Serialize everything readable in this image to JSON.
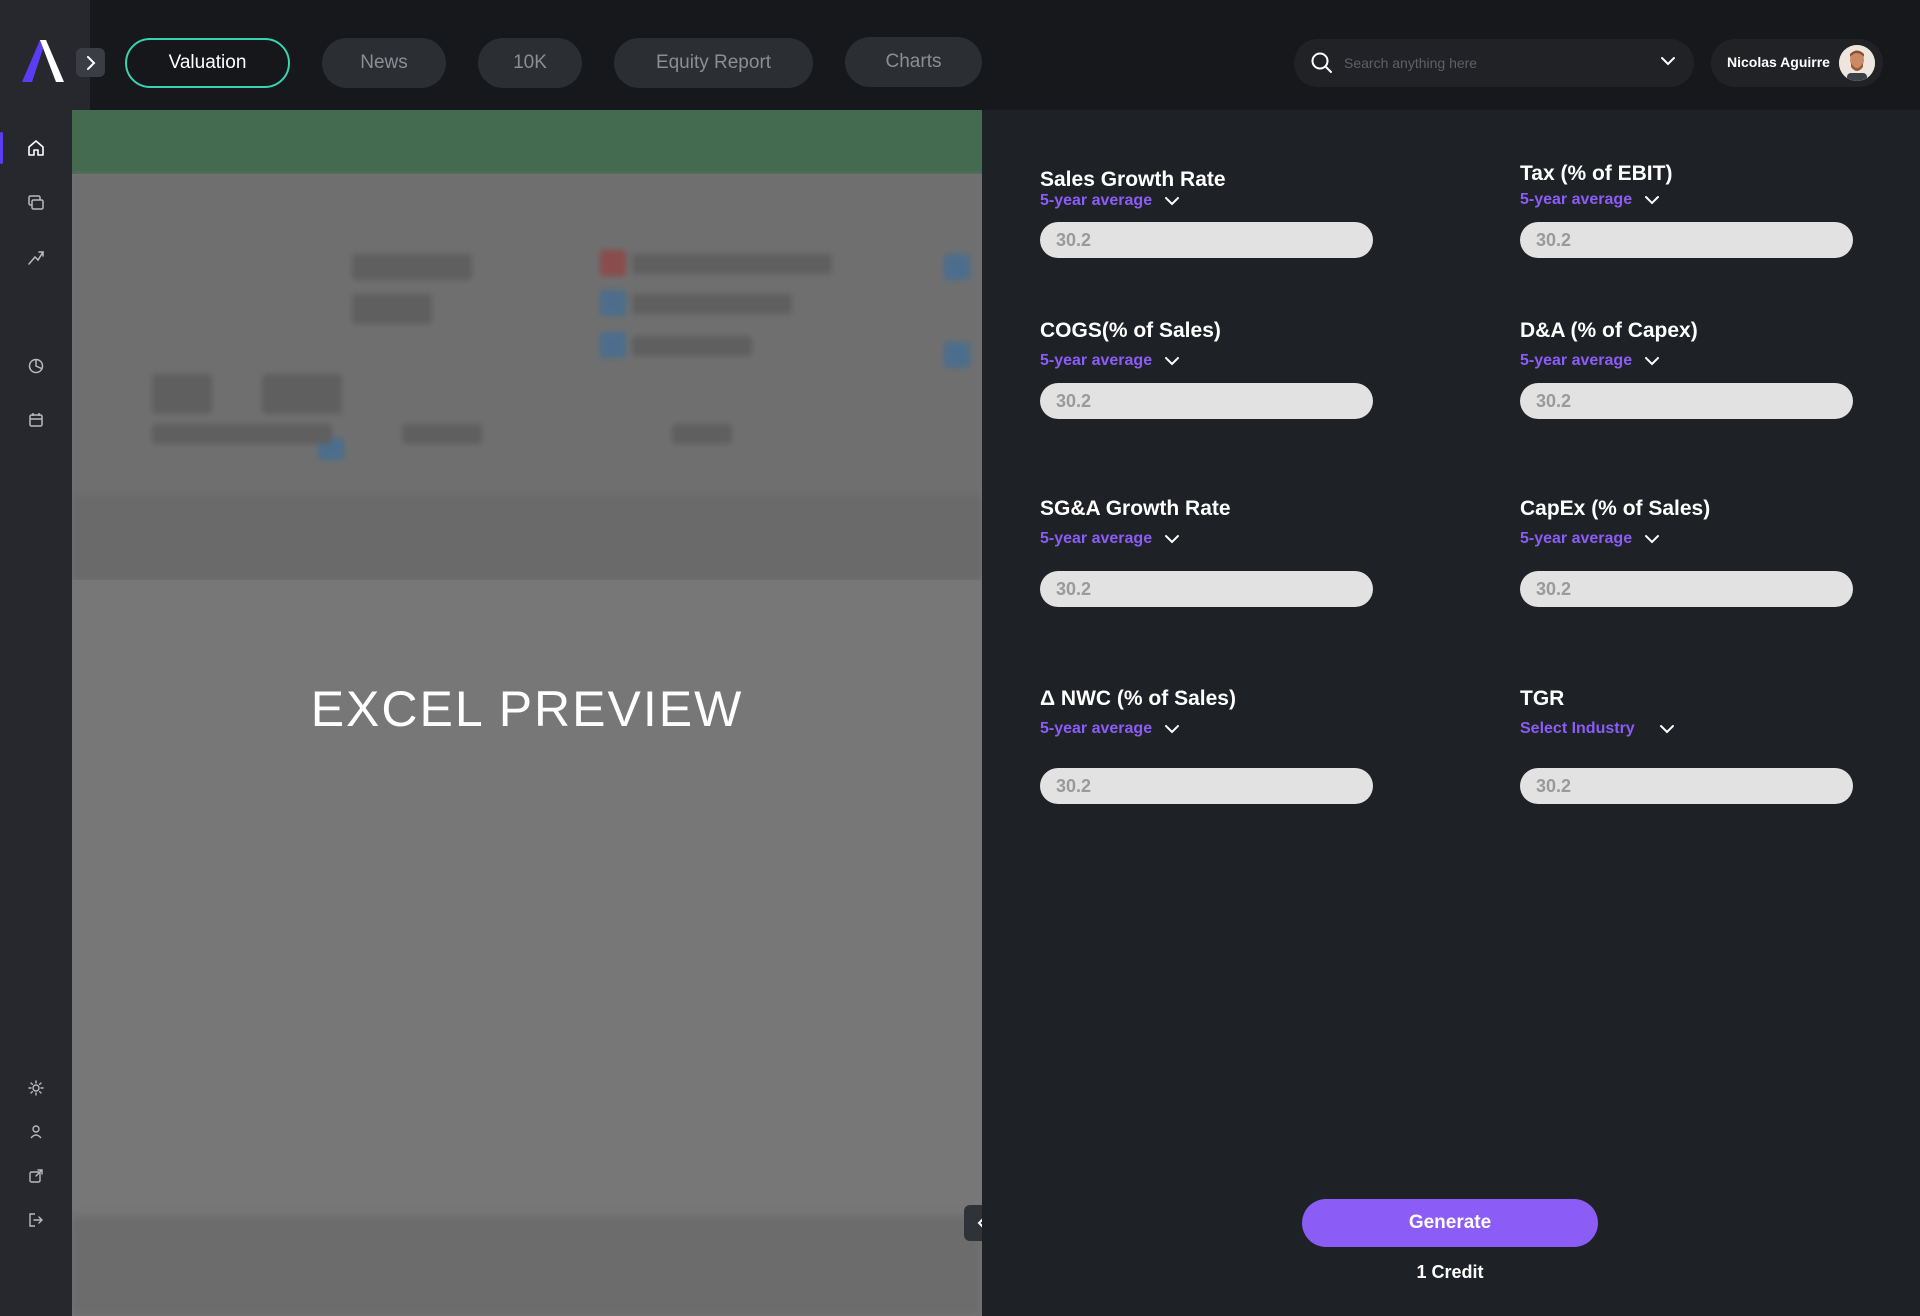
{
  "header": {
    "tabs": [
      {
        "label": "Valuation",
        "active": true
      },
      {
        "label": "News"
      },
      {
        "label": "10K"
      },
      {
        "label": "Equity Report"
      },
      {
        "label": "Charts"
      }
    ],
    "search": {
      "placeholder": "Search anything here",
      "icon": "search-icon"
    },
    "user": {
      "name": "Nicolas Aguirre"
    }
  },
  "sidebar": {
    "items": [
      "home-icon",
      "monitor-icon",
      "trend-up-icon",
      "pie-chart-icon",
      "calendar-icon"
    ],
    "bottom_items": [
      "sun-icon",
      "user-icon",
      "external-link-icon",
      "logout-icon"
    ]
  },
  "preview": {
    "title": "EXCEL PREVIEW"
  },
  "form": {
    "fields": [
      {
        "label": "Sales Growth Rate",
        "select": "5-year average",
        "value": "30.2"
      },
      {
        "label": "Tax (% of EBIT)",
        "select": "5-year average",
        "value": "30.2"
      },
      {
        "label": "COGS(% of Sales)",
        "select": "5-year average",
        "value": "30.2"
      },
      {
        "label": "D&A (% of Capex)",
        "select": "5-year average",
        "value": "30.2"
      },
      {
        "label": "SG&A Growth Rate",
        "select": "5-year average",
        "value": "30.2"
      },
      {
        "label": "CapEx (% of Sales)",
        "select": "5-year average",
        "value": "30.2"
      },
      {
        "label": "Δ NWC (% of Sales)",
        "select": "5-year average",
        "value": "30.2"
      },
      {
        "label": "TGR",
        "select": "Select Industry",
        "value": "30.2"
      }
    ],
    "generate_label": "Generate",
    "credit_text": "1 Credit"
  },
  "colors": {
    "accent": "#8b5cf6",
    "active_tab_border": "#3ad2b2",
    "logo": "#5b3cf0"
  }
}
